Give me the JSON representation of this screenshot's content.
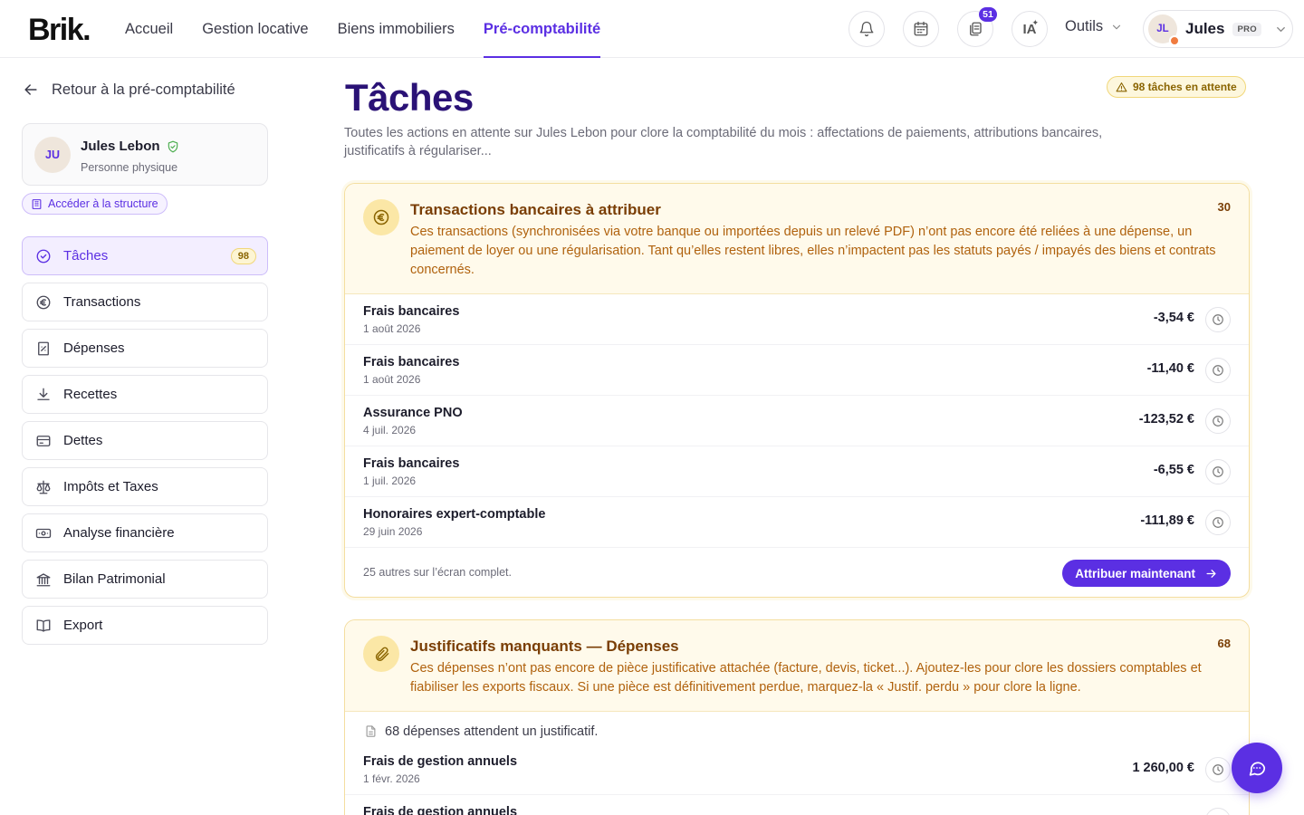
{
  "header": {
    "logo": "Brik.",
    "nav": [
      {
        "label": "Accueil",
        "active": false
      },
      {
        "label": "Gestion locative",
        "active": false
      },
      {
        "label": "Biens immobiliers",
        "active": false
      },
      {
        "label": "Pré-comptabilité",
        "active": true
      }
    ],
    "notifications_badge": "51",
    "ia_label": "IA",
    "tools_label": "Outils",
    "user": {
      "initials": "JL",
      "name": "Jules",
      "badge": "PRO"
    }
  },
  "sidebar": {
    "back_label": "Retour à la pré-comptabilité",
    "person": {
      "initials": "JU",
      "name": "Jules Lebon",
      "type": "Personne physique"
    },
    "structure_link": "Accéder à la structure",
    "items": [
      {
        "label": "Tâches",
        "icon": "check-circle-icon",
        "count": "98",
        "active": true
      },
      {
        "label": "Transactions",
        "icon": "euro-icon"
      },
      {
        "label": "Dépenses",
        "icon": "receipt-icon"
      },
      {
        "label": "Recettes",
        "icon": "download-icon"
      },
      {
        "label": "Dettes",
        "icon": "credit-card-icon"
      },
      {
        "label": "Impôts et Taxes",
        "icon": "scale-icon"
      },
      {
        "label": "Analyse financière",
        "icon": "banknote-icon"
      },
      {
        "label": "Bilan Patrimonial",
        "icon": "bank-icon"
      },
      {
        "label": "Export",
        "icon": "book-icon"
      }
    ]
  },
  "main": {
    "title": "Tâches",
    "pending_badge": "98 tâches en attente",
    "description": "Toutes les actions en attente sur Jules Lebon pour clore la comptabilité du mois : affectations de paiements, attributions bancaires, justificatifs à régulariser...",
    "transactions_card": {
      "title": "Transactions bancaires à attribuer",
      "count": "30",
      "description": "Ces transactions (synchronisées via votre banque ou importées depuis un relevé PDF) n’ont pas encore été reliées à une dépense, un paiement de loyer ou une régularisation. Tant qu’elles restent libres, elles n’impactent pas les statuts payés / impayés des biens et contrats concernés.",
      "rows": [
        {
          "name": "Frais bancaires",
          "date": "1 août 2026",
          "amount": "-3,54 €"
        },
        {
          "name": "Frais bancaires",
          "date": "1 août 2026",
          "amount": "-11,40 €"
        },
        {
          "name": "Assurance PNO",
          "date": "4 juil. 2026",
          "amount": "-123,52 €"
        },
        {
          "name": "Frais bancaires",
          "date": "1 juil. 2026",
          "amount": "-6,55 €"
        },
        {
          "name": "Honoraires expert-comptable",
          "date": "29 juin 2026",
          "amount": "-111,89 €"
        }
      ],
      "more_text": "25 autres sur l’écran complet.",
      "cta_label": "Attribuer maintenant"
    },
    "receipts_card": {
      "title": "Justificatifs manquants — Dépenses",
      "count": "68",
      "description": "Ces dépenses n’ont pas encore de pièce justificative attachée (facture, devis, ticket...). Ajoutez-les pour clore les dossiers comptables et fiabiliser les exports fiscaux. Si une pièce est définitivement perdue, marquez-la « Justif. perdu » pour clore la ligne.",
      "note": "68 dépenses attendent un justificatif.",
      "rows": [
        {
          "name": "Frais de gestion annuels",
          "date": "1 févr. 2026",
          "amount": "1 260,00 €"
        },
        {
          "name": "Frais de gestion annuels",
          "date": "",
          "amount": ""
        }
      ]
    }
  }
}
